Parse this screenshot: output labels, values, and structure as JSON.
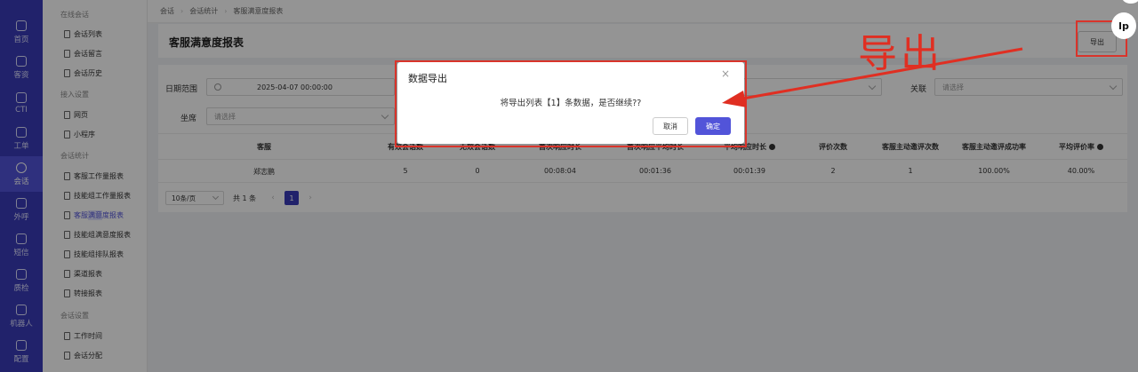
{
  "nav": {
    "items": [
      {
        "label": "首页"
      },
      {
        "label": "客资"
      },
      {
        "label": "CTI"
      },
      {
        "label": "工单"
      },
      {
        "label": "会话"
      },
      {
        "label": "外呼"
      },
      {
        "label": "短信"
      },
      {
        "label": "质检"
      },
      {
        "label": "机器人"
      },
      {
        "label": "配置"
      }
    ]
  },
  "submenu": {
    "groups": [
      "在线会话",
      "接入设置",
      "会话统计",
      "会话设置"
    ],
    "items": [
      "会话列表",
      "会话留言",
      "会话历史",
      "网页",
      "小程序",
      "客服工作量报表",
      "技能组工作量报表",
      "客服满意度报表",
      "技能组满意度报表",
      "技能组排队报表",
      "渠道报表",
      "转接报表",
      "工作时间",
      "会话分配"
    ],
    "active_prefix": "客服",
    "active_highlight": "满意",
    "active_suffix": "度报表"
  },
  "breadcrumb": [
    "会话",
    "会话统计",
    "客服满意度报表"
  ],
  "header": {
    "title": "客服满意度报表",
    "export_label": "导出"
  },
  "filters": {
    "date_label": "日期范围",
    "date_start": "2025-04-07 00:00:00",
    "seat_label": "坐席",
    "seat_placeholder": "请选择",
    "related_label": "关联",
    "related_placeholder": "请选择"
  },
  "table": {
    "headers": [
      "客服",
      "有效会话数",
      "无效会话数",
      "首次响应时长",
      "首次响应平均时长",
      "平均响应时长",
      "评价次数",
      "客服主动邀评次数",
      "客服主动邀评成功率",
      "平均评价率"
    ],
    "row": [
      "郑志鹏",
      "5",
      "0",
      "00:08:04",
      "00:01:36",
      "00:01:39",
      "2",
      "1",
      "100.00%",
      "40.00%"
    ]
  },
  "pagination": {
    "page_size": "10条/页",
    "total": "共 1 条",
    "current": "1"
  },
  "dialog": {
    "title": "数据导出",
    "close": "×",
    "message": "将导出列表【1】条数据，是否继续??",
    "cancel": "取消",
    "ok": "确定"
  },
  "annotation": {
    "text": "导出",
    "color": "#e02f22"
  },
  "corner_icon": "lp",
  "colors": {
    "brand": "#3a3cb8",
    "primary": "#5254d9",
    "annotation": "#d9342b"
  }
}
